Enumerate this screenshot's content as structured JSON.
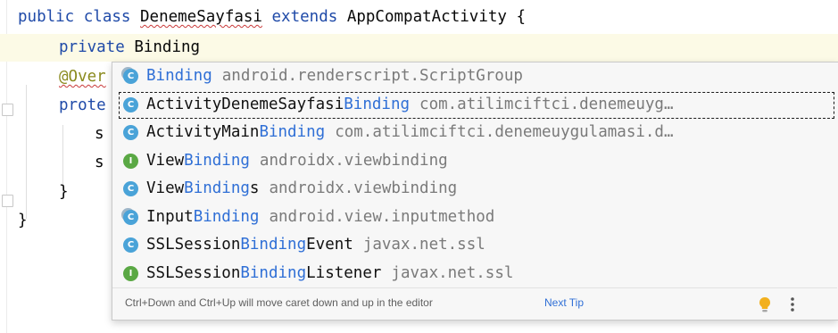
{
  "editor": {
    "line1": {
      "kw1": "public",
      "kw2": "class",
      "name": "DenemeSayfasi",
      "kw3": "extends",
      "parent": "AppCompatActivity",
      "brace": "{"
    },
    "line2": {
      "kw": "private",
      "typed": "Binding"
    },
    "line3": {
      "annotation": "@Over"
    },
    "line4": {
      "kw": "prote"
    },
    "line5": {
      "text": "s"
    },
    "line6": {
      "text": "s"
    },
    "line7": {
      "brace": "}"
    },
    "line8": {
      "brace": "}"
    }
  },
  "completion": {
    "items": [
      {
        "icon": "class-icon",
        "pre": "",
        "match": "Binding",
        "post": "",
        "pkg": "android.renderscript.ScriptGroup"
      },
      {
        "icon": "class-icon",
        "pre": "ActivityDenemeSayfasi",
        "match": "Binding",
        "post": "",
        "pkg": "com.atilimciftci.denemeuyg…"
      },
      {
        "icon": "class-icon",
        "pre": "ActivityMain",
        "match": "Binding",
        "post": "",
        "pkg": "com.atilimciftci.denemeuygulamasi.d…"
      },
      {
        "icon": "interface-icon",
        "pre": "View",
        "match": "Binding",
        "post": "",
        "pkg": "androidx.viewbinding"
      },
      {
        "icon": "class-icon",
        "pre": "View",
        "match": "Binding",
        "post": "s",
        "pkg": "androidx.viewbinding"
      },
      {
        "icon": "class-icon",
        "pre": "Input",
        "match": "Binding",
        "post": "",
        "pkg": "android.view.inputmethod"
      },
      {
        "icon": "class-icon",
        "pre": "SSLSession",
        "match": "Binding",
        "post": "Event",
        "pkg": "javax.net.ssl"
      },
      {
        "icon": "interface-icon",
        "pre": "SSLSession",
        "match": "Binding",
        "post": "Listener",
        "pkg": "javax.net.ssl"
      }
    ],
    "icon_letters": {
      "class": "C",
      "interface": "I"
    },
    "selected_index": 1,
    "footer": {
      "hint": "Ctrl+Down and Ctrl+Up will move caret down and up in the editor",
      "next_tip": "Next Tip"
    }
  },
  "colors": {
    "keyword": "#1f4aa8",
    "match": "#2f6fd6",
    "class_icon": "#4aa3d8",
    "interface_icon": "#5aa844",
    "current_line": "#fcfae6"
  }
}
